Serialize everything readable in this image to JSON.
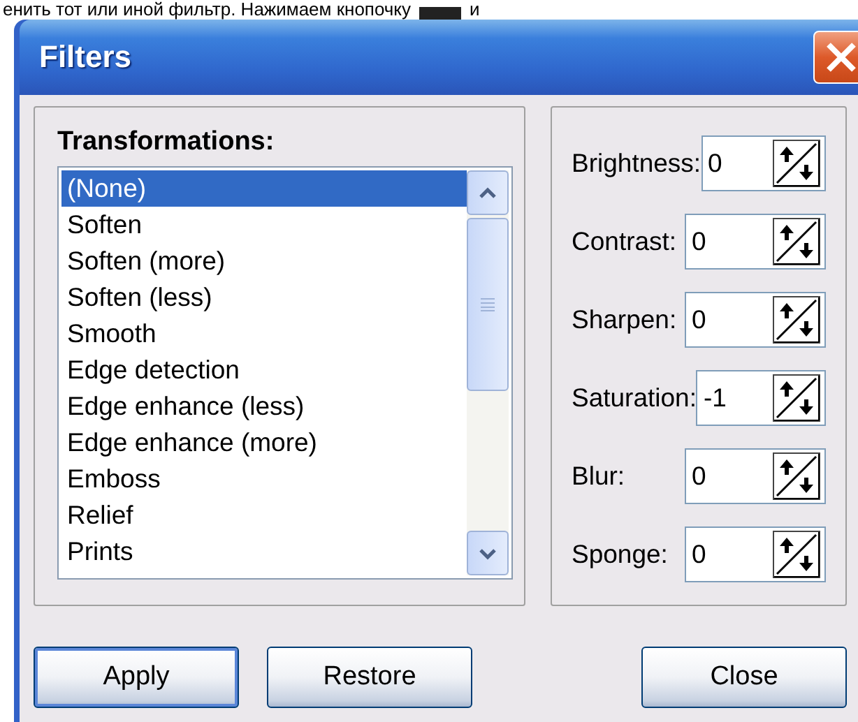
{
  "page_text": {
    "before": "енить тот или иной фильтр. Нажимаем кнопочку",
    "after": "и"
  },
  "window": {
    "title": "Filters"
  },
  "transformations": {
    "label": "Transformations:",
    "items": [
      {
        "label": "(None)",
        "selected": true
      },
      {
        "label": "Soften",
        "selected": false
      },
      {
        "label": "Soften (more)",
        "selected": false
      },
      {
        "label": "Soften (less)",
        "selected": false
      },
      {
        "label": "Smooth",
        "selected": false
      },
      {
        "label": "Edge detection",
        "selected": false
      },
      {
        "label": "Edge enhance (less)",
        "selected": false
      },
      {
        "label": "Edge enhance (more)",
        "selected": false
      },
      {
        "label": "Emboss",
        "selected": false
      },
      {
        "label": "Relief",
        "selected": false
      },
      {
        "label": "Prints",
        "selected": false
      }
    ]
  },
  "adjustments": [
    {
      "label": "Brightness:",
      "value": "0"
    },
    {
      "label": "Contrast:",
      "value": "0"
    },
    {
      "label": "Sharpen:",
      "value": "0"
    },
    {
      "label": "Saturation:",
      "value": "-1"
    },
    {
      "label": "Blur:",
      "value": "0"
    },
    {
      "label": "Sponge:",
      "value": "0"
    }
  ],
  "buttons": [
    {
      "label": "Apply",
      "default": true
    },
    {
      "label": "Restore",
      "default": false
    },
    {
      "label": "Close",
      "default": false
    }
  ]
}
